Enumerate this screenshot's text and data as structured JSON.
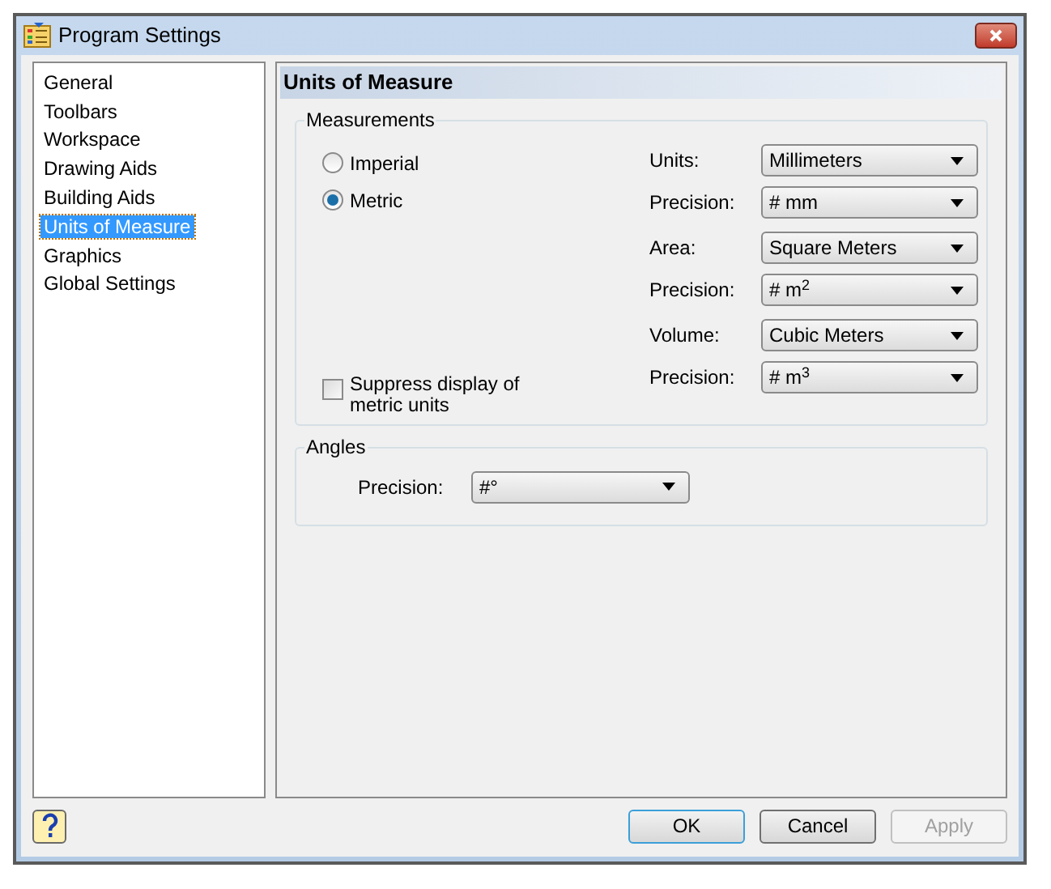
{
  "window": {
    "title": "Program Settings"
  },
  "sidebar": {
    "items": [
      {
        "label": "General",
        "selected": false
      },
      {
        "label": "Toolbars",
        "selected": false
      },
      {
        "label": "Workspace",
        "selected": false
      },
      {
        "label": "Drawing Aids",
        "selected": false
      },
      {
        "label": "Building Aids",
        "selected": false
      },
      {
        "label": "Units of Measure",
        "selected": true
      },
      {
        "label": "Graphics",
        "selected": false
      },
      {
        "label": "Global Settings",
        "selected": false
      }
    ]
  },
  "panel": {
    "title": "Units of Measure",
    "measurements": {
      "title": "Measurements",
      "radios": [
        {
          "label": "Imperial",
          "selected": false
        },
        {
          "label": "Metric",
          "selected": true
        }
      ],
      "suppress": {
        "label": "Suppress display of metric units",
        "checked": false
      },
      "groups": [
        [
          {
            "label": "Units:",
            "value": "Millimeters"
          },
          {
            "label": "Precision:",
            "value": "# mm"
          }
        ],
        [
          {
            "label": "Area:",
            "value": "Square Meters"
          },
          {
            "label": "Precision:",
            "value": "# m$^{2}$"
          }
        ],
        [
          {
            "label": "Volume:",
            "value": "Cubic Meters"
          },
          {
            "label": "Precision:",
            "value": "# m$^{3}$"
          }
        ]
      ]
    },
    "angles": {
      "title": "Angles",
      "label": "Precision:",
      "value": "#°"
    }
  },
  "buttons": [
    {
      "label": "OK",
      "disabled": false
    },
    {
      "label": "Cancel",
      "disabled": false
    },
    {
      "label": "Apply",
      "disabled": true
    }
  ]
}
